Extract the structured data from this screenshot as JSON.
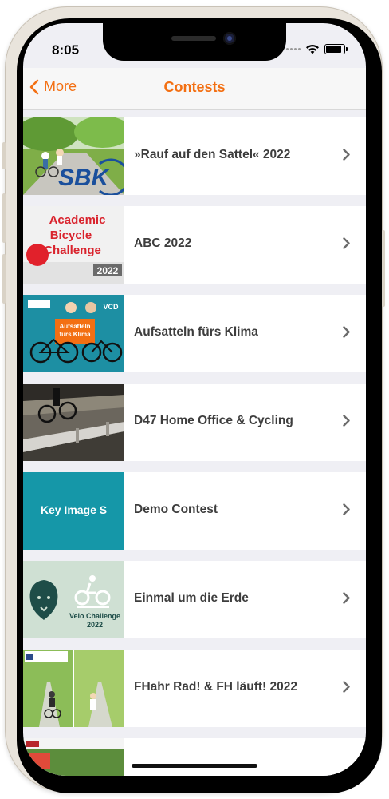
{
  "status": {
    "time": "8:05"
  },
  "nav": {
    "back_label": "More",
    "title": "Contests"
  },
  "colors": {
    "accent": "#f36f12",
    "teal": "#1597a8"
  },
  "contests": [
    {
      "label": "»Rauf auf den Sattel« 2022",
      "thumb_text": "SBK"
    },
    {
      "label": "ABC 2022",
      "thumb_text": "Academic Bicycle Challenge",
      "thumb_year": "2022"
    },
    {
      "label": "Aufsatteln fürs Klima",
      "thumb_text": "Aufsatteln fürs Klima",
      "thumb_logo": "VCD"
    },
    {
      "label": "D47 Home Office & Cycling"
    },
    {
      "label": "Demo Contest",
      "thumb_text": "Key Image S"
    },
    {
      "label": "Einmal um die Erde",
      "thumb_text": "Velo Challenge 2022"
    },
    {
      "label": "FHahr Rad! & FH läuft! 2022"
    }
  ],
  "icons": [
    "chevron-left-icon",
    "chevron-right-icon",
    "wifi-icon",
    "battery-icon",
    "signal-icon"
  ]
}
